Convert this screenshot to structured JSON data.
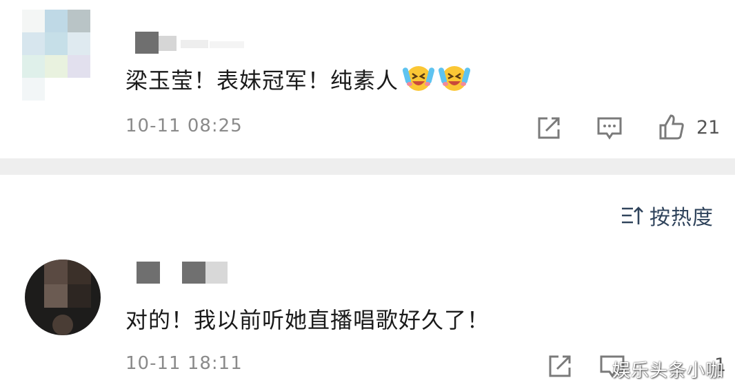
{
  "comments": [
    {
      "text": "梁玉莹！表妹冠军！纯素人",
      "emoji": [
        "laugh-cry-emoji",
        "laugh-cry-emoji"
      ],
      "time": "10-11 08:25",
      "likes": "21"
    },
    {
      "text": "对的！我以前听她直播唱歌好久了！",
      "time": "10-11 18:11",
      "likes": "1"
    }
  ],
  "sort": {
    "label": "按热度",
    "icon": "sort-icon"
  },
  "watermark": "娱乐头条小咖",
  "colors": {
    "accent": "#30445c",
    "muted": "#8a8a8a",
    "separator": "#eeeeee"
  }
}
